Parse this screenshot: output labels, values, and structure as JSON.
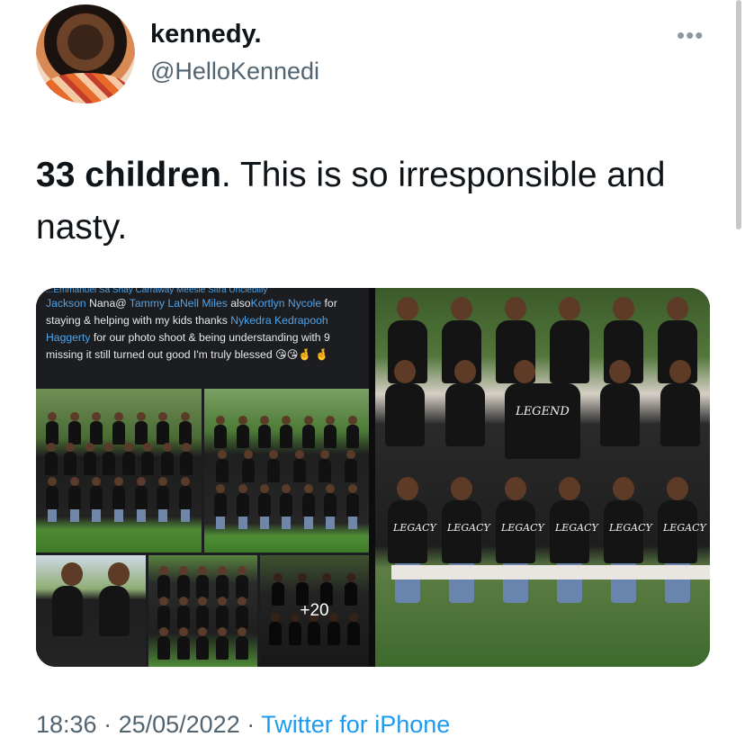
{
  "author": {
    "display_name": "kennedy.",
    "handle": "@HelloKennedi"
  },
  "menu": {
    "more_label": "•••"
  },
  "tweet": {
    "bold_part": "33 children",
    "rest": ". This is so irresponsible and nasty."
  },
  "media": {
    "caption_top_cut": "...Emmanuel Sa Shay Carraway  Meesie Sitra  Unclebilly",
    "caption": {
      "link1": "Jackson",
      "t1": " Nana@ ",
      "link2": "Tammy LaNell Miles",
      "t2": " also",
      "link3": "Kortlyn Nycole",
      "t3": " for staying & helping with my kids thanks ",
      "link4": "Nykedra Kedrapooh Haggerty",
      "t4": " for our photo shoot & being understanding with 9 missing it still turned out good I'm truly blessed 😘😘🤞 🤞"
    },
    "more_photos_label": "+20",
    "shirt_text": "LEGACY",
    "hat_text": "LEGEND"
  },
  "footer": {
    "time": "18:36",
    "separator": " · ",
    "date": "25/05/2022",
    "source": "Twitter for iPhone"
  }
}
